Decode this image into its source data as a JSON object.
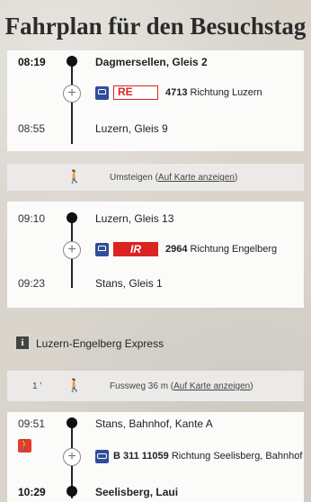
{
  "page": {
    "title": "Fahrplan für den Besuchstag"
  },
  "leg1": {
    "dep_time": "08:19",
    "dep_station": "Dagmersellen, Gleis 2",
    "badge": "RE",
    "number": "4713",
    "direction": "Richtung Luzern",
    "arr_time": "08:55",
    "arr_station": "Luzern, Gleis 9"
  },
  "transfer1": {
    "text": "Umsteigen (",
    "link": "Auf Karte anzeigen",
    "close": ")"
  },
  "leg2": {
    "dep_time": "09:10",
    "dep_station": "Luzern, Gleis 13",
    "badge": "IR",
    "number": "2964",
    "direction": "Richtung Engelberg",
    "arr_time": "09:23",
    "arr_station": "Stans, Gleis 1"
  },
  "info": {
    "text": "Luzern-Engelberg Express"
  },
  "walk": {
    "duration": "1 '",
    "text": "Fussweg 36 m (",
    "link": "Auf Karte anzeigen",
    "close": ")"
  },
  "leg3": {
    "dep_time": "09:51",
    "dep_station": "Stans, Bahnhof, Kante A",
    "number": "B 311 11059",
    "direction": "Richtung Seelisberg, Bahnhof",
    "arr_time": "10:29",
    "arr_station": "Seelisberg, Laui"
  },
  "colors": {
    "accent_red": "#d22222",
    "sbb_blue": "#2f4e9a"
  }
}
